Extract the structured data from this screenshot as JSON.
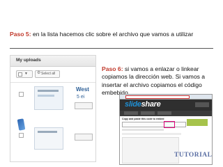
{
  "step5": {
    "label": "Paso 5:",
    "text": " en la lista hacemos clic sobre el archivo que vamos a utilizar"
  },
  "step6": {
    "label": "Paso 6:",
    "text": " si vamos a enlazar o linkear copiamos la dirección web. Si vamos a insertar el archivo copiamos el código embebido"
  },
  "uploads": {
    "title": "My uploads",
    "select_all": "Select all",
    "item_title": "West",
    "item_sub": "5 ei"
  },
  "slideshare": {
    "logo_slide": "slide",
    "logo_share": "share",
    "copy_text": "Copy and paste this code to embed"
  },
  "badge": {
    "text": "TUTORIAL"
  },
  "colors": {
    "step_label": "#c0392b",
    "link_blue": "#2d5f97",
    "tutorial": "#5a6ea3"
  }
}
